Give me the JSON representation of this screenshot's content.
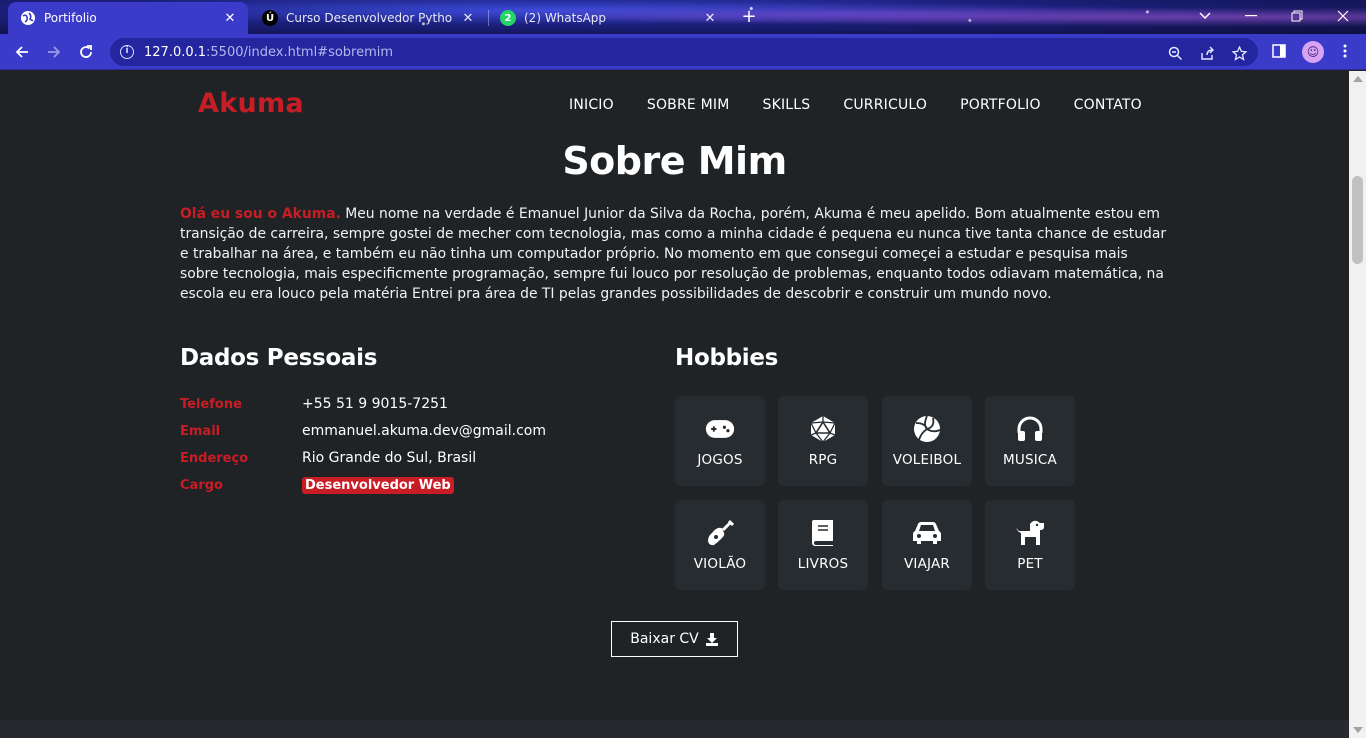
{
  "browser": {
    "tabs": [
      {
        "title": "Portifolio",
        "active": true
      },
      {
        "title": "Curso Desenvolvedor Python Con",
        "active": false
      },
      {
        "title": "(2) WhatsApp",
        "active": false
      }
    ],
    "whatsapp_count": "2",
    "url_host": "127.0.0.1",
    "url_rest": ":5500/index.html#sobremim",
    "accent_color": "#3a3cc9"
  },
  "header": {
    "logo": "Akuma",
    "nav": [
      "INICIO",
      "SOBRE MIM",
      "SKILLS",
      "CURRICULO",
      "PORTFOLIO",
      "CONTATO"
    ]
  },
  "about": {
    "title": "Sobre Mim",
    "intro_highlight": "Olá eu sou o Akuma.",
    "intro_text": " Meu nome na verdade é Emanuel Junior da Silva da Rocha, porém, Akuma é meu apelido. Bom atualmente estou em transição de carreira, sempre gostei de mecher com tecnologia, mas como a minha cidade é pequena eu nunca tive tanta chance de estudar e trabalhar na área, e também eu não tinha um computador próprio. No momento em que consegui começei a estudar e pesquisa mais sobre tecnologia, mais especificmente programação, sempre fui louco por resolução de problemas, enquanto todos odiavam matemática, na escola eu era louco pela matéria Entrei pra área de TI pelas grandes possibilidades de descobrir e construir um mundo novo."
  },
  "personal": {
    "title": "Dados Pessoais",
    "rows": [
      {
        "label": "Telefone",
        "value": "+55 51 9 9015-7251"
      },
      {
        "label": "Email",
        "value": "emmanuel.akuma.dev@gmail.com"
      },
      {
        "label": "Endereço",
        "value": "Rio Grande do Sul, Brasil"
      },
      {
        "label": "Cargo",
        "value": "Desenvolvedor Web"
      }
    ]
  },
  "hobbies": {
    "title": "Hobbies",
    "items": [
      {
        "label": "JOGOS",
        "icon": "gamepad-icon"
      },
      {
        "label": "RPG",
        "icon": "d20-dice-icon"
      },
      {
        "label": "VOLEIBOL",
        "icon": "volleyball-icon"
      },
      {
        "label": "MUSICA",
        "icon": "headphones-icon"
      },
      {
        "label": "VIOLÃO",
        "icon": "guitar-icon"
      },
      {
        "label": "LIVROS",
        "icon": "book-icon"
      },
      {
        "label": "VIAJAR",
        "icon": "car-icon"
      },
      {
        "label": "PET",
        "icon": "dog-icon"
      }
    ]
  },
  "cv_button": "Baixar CV",
  "brand_red": "#c81d25"
}
